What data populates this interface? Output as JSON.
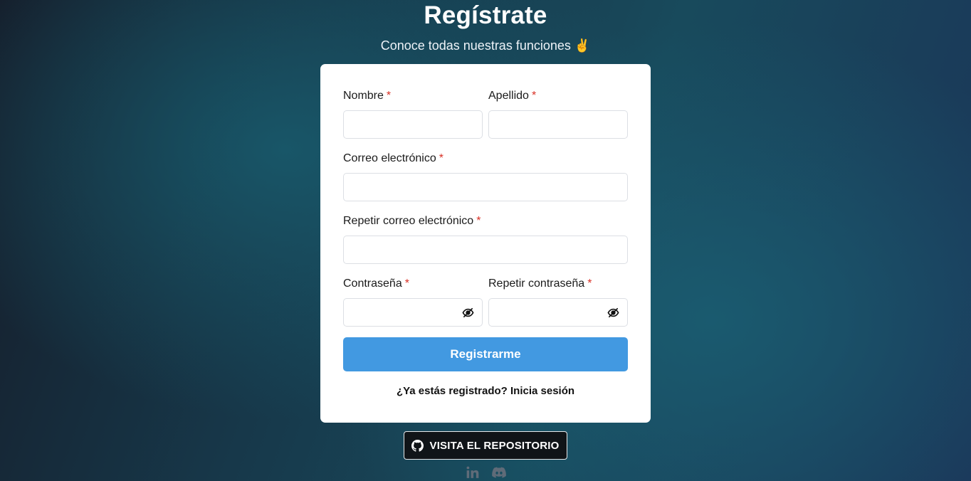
{
  "header": {
    "title": "Regístrate",
    "subtitle": "Conoce todas nuestras funciones ✌️"
  },
  "form": {
    "required_mark": "*",
    "first_name": {
      "label": "Nombre",
      "value": "",
      "placeholder": ""
    },
    "last_name": {
      "label": "Apellido",
      "value": "",
      "placeholder": ""
    },
    "email": {
      "label": "Correo electrónico",
      "value": "",
      "placeholder": ""
    },
    "email_repeat": {
      "label": "Repetir correo electrónico",
      "value": "",
      "placeholder": ""
    },
    "password": {
      "label": "Contraseña",
      "value": "",
      "placeholder": "",
      "icon": "eye-slash-icon"
    },
    "password_repeat": {
      "label": "Repetir contraseña",
      "value": "",
      "placeholder": "",
      "icon": "eye-slash-icon"
    },
    "submit_label": "Registrarme",
    "login_prompt": "¿Ya estás registrado? Inicia sesión"
  },
  "footer": {
    "repo_button": {
      "label": "VISITA EL REPOSITORIO",
      "icon": "github-icon"
    },
    "social": [
      {
        "name": "linkedin",
        "icon": "linkedin-icon"
      },
      {
        "name": "discord",
        "icon": "discord-icon"
      }
    ]
  },
  "colors": {
    "primary_button": "#4299e1",
    "required": "#d93025",
    "card": "#ffffff",
    "repo_button_bg": "#101418"
  }
}
